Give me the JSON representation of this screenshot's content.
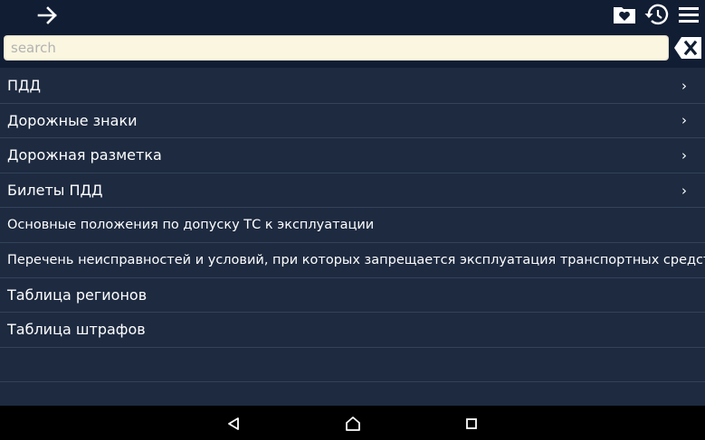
{
  "search": {
    "placeholder": "search",
    "value": ""
  },
  "menu": {
    "items": [
      {
        "label": "ПДД",
        "has_submenu": true
      },
      {
        "label": "Дорожные знаки",
        "has_submenu": true
      },
      {
        "label": "Дорожная разметка",
        "has_submenu": true
      },
      {
        "label": "Билеты ПДД",
        "has_submenu": true
      },
      {
        "label": "Основные положения по допуску ТС к эксплуатации",
        "has_submenu": false
      },
      {
        "label": "Перечень неисправностей и условий, при которых запрещается эксплуатация транспортных средств",
        "has_submenu": false
      },
      {
        "label": "Таблица регионов",
        "has_submenu": false
      },
      {
        "label": "Таблица штрафов",
        "has_submenu": false
      }
    ],
    "chevron": "›"
  },
  "colors": {
    "background": "#1d2a40",
    "topbar": "#101d33",
    "divider": "#34425a",
    "search_background": "#fbf6e0",
    "text": "#ffffff",
    "navbar": "#000000"
  },
  "icons": {
    "forward": "arrow-right-icon",
    "favorites": "folder-heart-icon",
    "history": "history-icon",
    "menu": "hamburger-menu-icon",
    "clear": "backspace-clear-icon",
    "nav_back": "triangle-back-icon",
    "nav_home": "home-icon",
    "nav_recents": "square-recents-icon"
  }
}
